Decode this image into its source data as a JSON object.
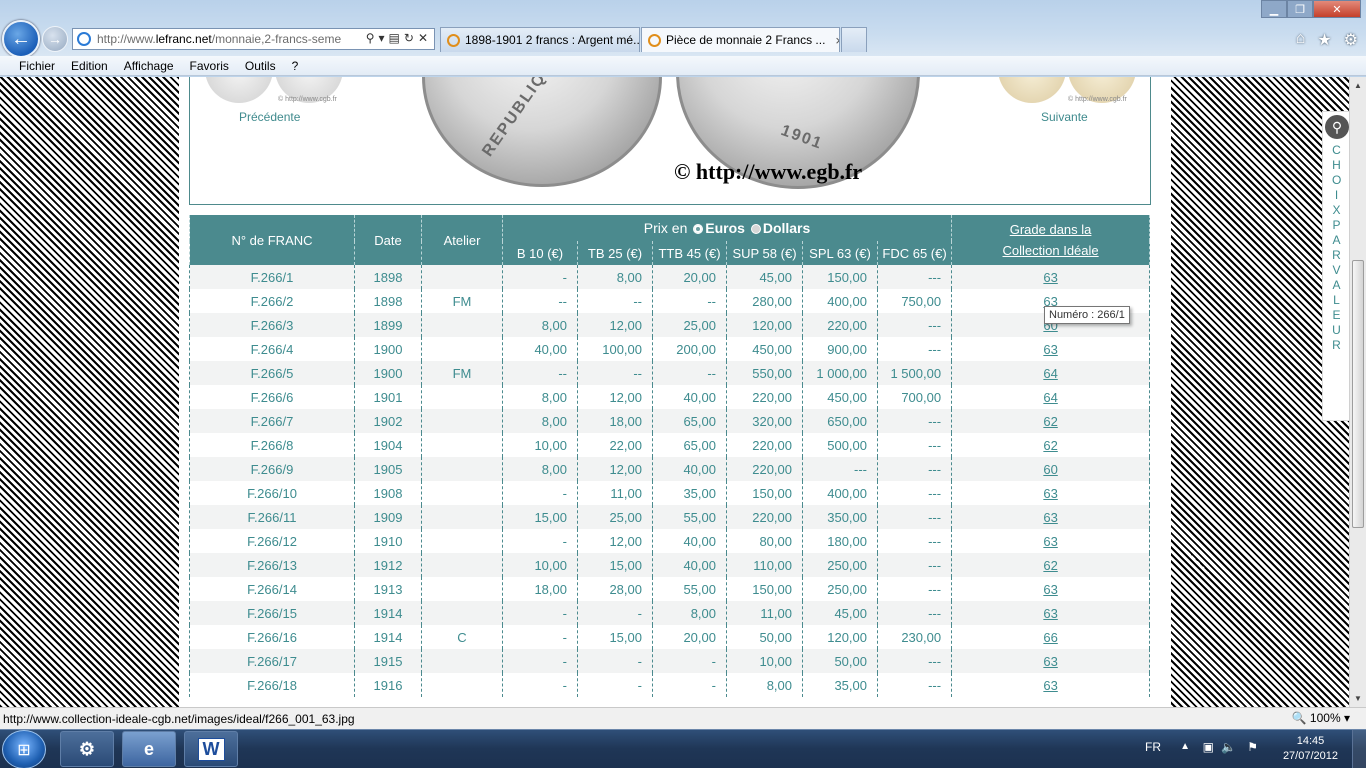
{
  "browser": {
    "address_url_prefix": "http://www.",
    "address_url_domain": "lefranc.net",
    "address_url_rest": "/monnaie,2-francs-seme",
    "tabs": [
      {
        "label": "1898-1901 2 francs : Argent mé...",
        "active": false
      },
      {
        "label": "Pièce de monnaie 2 Francs ...",
        "active": true
      }
    ],
    "tab_close": "×",
    "menu": [
      "Fichier",
      "Edition",
      "Affichage",
      "Favoris",
      "Outils",
      "?"
    ],
    "status_url": "http://www.collection-ideale-cgb.net/images/ideal/f266_001_63.jpg",
    "zoom": "100%"
  },
  "page": {
    "prev_label": "Précédente",
    "next_label": "Suivante",
    "thumb_credit": "© http://www.cgb.fr",
    "coin_copyright": "© http://www.egb.fr",
    "coin_obverse_text": "REPUBLIQUE",
    "coin_reverse_text": "1901",
    "sidebar_choix": "CHOIX PAR VALEUR",
    "tooltip": "Numéro : 266/1"
  },
  "table": {
    "col_number": "N° de FRANC",
    "col_date": "Date",
    "col_atelier": "Atelier",
    "prix_en": "Prix en",
    "currency_euros": "Euros",
    "currency_dollars": "Dollars",
    "grades": [
      "B 10 (€)",
      "TB 25 (€)",
      "TTB 45 (€)",
      "SUP 58 (€)",
      "SPL 63 (€)",
      "FDC 65 (€)"
    ],
    "col_grade_line1": "Grade dans la",
    "col_grade_line2": "Collection Idéale",
    "rows": [
      {
        "num": "F.266/1",
        "date": "1898",
        "atelier": "",
        "b": "-",
        "tb": "8,00",
        "ttb": "20,00",
        "sup": "45,00",
        "spl": "150,00",
        "fdc": "---",
        "grade": "63"
      },
      {
        "num": "F.266/2",
        "date": "1898",
        "atelier": "FM",
        "b": "--",
        "tb": "--",
        "ttb": "--",
        "sup": "280,00",
        "spl": "400,00",
        "fdc": "750,00",
        "grade": "63"
      },
      {
        "num": "F.266/3",
        "date": "1899",
        "atelier": "",
        "b": "8,00",
        "tb": "12,00",
        "ttb": "25,00",
        "sup": "120,00",
        "spl": "220,00",
        "fdc": "---",
        "grade": "60"
      },
      {
        "num": "F.266/4",
        "date": "1900",
        "atelier": "",
        "b": "40,00",
        "tb": "100,00",
        "ttb": "200,00",
        "sup": "450,00",
        "spl": "900,00",
        "fdc": "---",
        "grade": "63"
      },
      {
        "num": "F.266/5",
        "date": "1900",
        "atelier": "FM",
        "b": "--",
        "tb": "--",
        "ttb": "--",
        "sup": "550,00",
        "spl": "1 000,00",
        "fdc": "1 500,00",
        "grade": "64"
      },
      {
        "num": "F.266/6",
        "date": "1901",
        "atelier": "",
        "b": "8,00",
        "tb": "12,00",
        "ttb": "40,00",
        "sup": "220,00",
        "spl": "450,00",
        "fdc": "700,00",
        "grade": "64"
      },
      {
        "num": "F.266/7",
        "date": "1902",
        "atelier": "",
        "b": "8,00",
        "tb": "18,00",
        "ttb": "65,00",
        "sup": "320,00",
        "spl": "650,00",
        "fdc": "---",
        "grade": "62"
      },
      {
        "num": "F.266/8",
        "date": "1904",
        "atelier": "",
        "b": "10,00",
        "tb": "22,00",
        "ttb": "65,00",
        "sup": "220,00",
        "spl": "500,00",
        "fdc": "---",
        "grade": "62"
      },
      {
        "num": "F.266/9",
        "date": "1905",
        "atelier": "",
        "b": "8,00",
        "tb": "12,00",
        "ttb": "40,00",
        "sup": "220,00",
        "spl": "---",
        "fdc": "---",
        "grade": "60"
      },
      {
        "num": "F.266/10",
        "date": "1908",
        "atelier": "",
        "b": "-",
        "tb": "11,00",
        "ttb": "35,00",
        "sup": "150,00",
        "spl": "400,00",
        "fdc": "---",
        "grade": "63"
      },
      {
        "num": "F.266/11",
        "date": "1909",
        "atelier": "",
        "b": "15,00",
        "tb": "25,00",
        "ttb": "55,00",
        "sup": "220,00",
        "spl": "350,00",
        "fdc": "---",
        "grade": "63"
      },
      {
        "num": "F.266/12",
        "date": "1910",
        "atelier": "",
        "b": "-",
        "tb": "12,00",
        "ttb": "40,00",
        "sup": "80,00",
        "spl": "180,00",
        "fdc": "---",
        "grade": "63"
      },
      {
        "num": "F.266/13",
        "date": "1912",
        "atelier": "",
        "b": "10,00",
        "tb": "15,00",
        "ttb": "40,00",
        "sup": "110,00",
        "spl": "250,00",
        "fdc": "---",
        "grade": "62"
      },
      {
        "num": "F.266/14",
        "date": "1913",
        "atelier": "",
        "b": "18,00",
        "tb": "28,00",
        "ttb": "55,00",
        "sup": "150,00",
        "spl": "250,00",
        "fdc": "---",
        "grade": "63"
      },
      {
        "num": "F.266/15",
        "date": "1914",
        "atelier": "",
        "b": "-",
        "tb": "-",
        "ttb": "8,00",
        "sup": "11,00",
        "spl": "45,00",
        "fdc": "---",
        "grade": "63"
      },
      {
        "num": "F.266/16",
        "date": "1914",
        "atelier": "C",
        "b": "-",
        "tb": "15,00",
        "ttb": "20,00",
        "sup": "50,00",
        "spl": "120,00",
        "fdc": "230,00",
        "grade": "66"
      },
      {
        "num": "F.266/17",
        "date": "1915",
        "atelier": "",
        "b": "-",
        "tb": "-",
        "ttb": "-",
        "sup": "10,00",
        "spl": "50,00",
        "fdc": "---",
        "grade": "63"
      },
      {
        "num": "F.266/18",
        "date": "1916",
        "atelier": "",
        "b": "-",
        "tb": "-",
        "ttb": "-",
        "sup": "8,00",
        "spl": "35,00",
        "fdc": "---",
        "grade": "63"
      }
    ]
  },
  "taskbar": {
    "language": "FR",
    "time": "14:45",
    "date": "27/07/2012"
  },
  "colors": {
    "table_header": "#4b8a8e",
    "text_teal": "#3e8c8f"
  }
}
